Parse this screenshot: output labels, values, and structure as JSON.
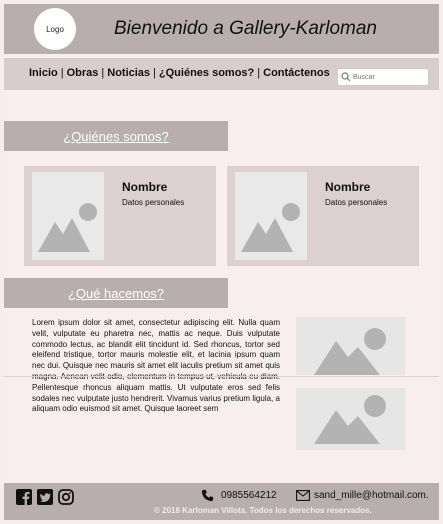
{
  "header": {
    "logo": "Logo",
    "title": "Bienvenido a Gallery-Karloman"
  },
  "nav": {
    "items": [
      "Inicio",
      "Obras",
      "Noticias",
      "¿Quiénes somos?",
      "Contáctenos"
    ],
    "search_placeholder": "Buscar"
  },
  "about": {
    "title": "¿Quiénes somos?",
    "cards": [
      {
        "name": "Nombre",
        "info": "Datos personales"
      },
      {
        "name": "Nombre",
        "info": "Datos personales"
      }
    ]
  },
  "what": {
    "title": "¿Qué hacemos?",
    "text": "Lorem ipsum dolor sit amet, consectetur adipiscing elit. Nulla quam velit, vulputate eu pharetra nec, mattis ac neque. Duis vulputate commodo lectus, ac blandit elit tincidunt id. Sed rhoncus, tortor sed eleifend tristique, tortor mauris molestie elit, et lacinia ipsum quam nec dui. Quisque nec mauris sit amet elit iaculis pretium sit amet quis magna. Aenean velit odio, elementum in tempus ut, vehicula eu diam. Pellentesque rhoncus aliquam mattis. Ut vulputate eros sed felis sodales nec vulputate justo hendrerit. Vivamus varius pretium ligula, a aliquam odio euismod sit amet. Quisque laoreet sem"
  },
  "footer": {
    "phone": "0985564212",
    "email": "sand_mille@hotmail.com.",
    "copyright": "© 2018 Karloman Villota. Todos los derechos reservados."
  },
  "icons": [
    "facebook-icon",
    "twitter-icon",
    "instagram-icon",
    "phone-icon",
    "mail-icon",
    "search-icon",
    "image-placeholder-icon"
  ],
  "colors": {
    "header": "#b9aeae",
    "nav": "#d9cccc",
    "background": "#f9eeee",
    "card": "#ddd0d0",
    "placeholder": "#b3b3b3"
  }
}
